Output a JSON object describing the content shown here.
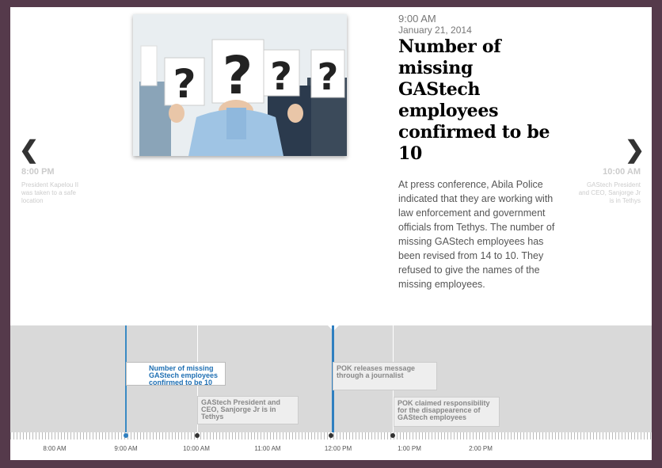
{
  "slide": {
    "time": "9:00 AM",
    "date": "January 21, 2014",
    "headline": "Number of missing GAStech employees confirmed to be 10",
    "body": "At press conference, Abila Police indicated that they are working with law enforcement and government officials from Tethys. The number of missing GAStech employees has been revised from 14 to 10. They refused to give the names of the missing employees."
  },
  "prev": {
    "arrow": "❮",
    "time": "8:00 PM",
    "desc": "President Kapelou II was taken to a safe location"
  },
  "next": {
    "arrow": "❯",
    "time": "10:00 AM",
    "desc": "GAStech President and CEO, Sanjorge Jr is in Tethys"
  },
  "timeline": {
    "cards": [
      {
        "text": "Number of missing GAStech employees confirmed to be 10"
      },
      {
        "text": "GAStech President and CEO, Sanjorge Jr is in Tethys"
      },
      {
        "text": "POK releases message through a journalist"
      },
      {
        "text": "POK claimed responsibility for the disappearence of GAStech employees"
      }
    ],
    "ticks": [
      "8:00 AM",
      "9:00 AM",
      "10:00 AM",
      "11:00 AM",
      "12:00 PM",
      "1:00 PM",
      "2:00 PM"
    ]
  },
  "icons": {
    "prev": "chevron-left-icon",
    "next": "chevron-right-icon"
  }
}
